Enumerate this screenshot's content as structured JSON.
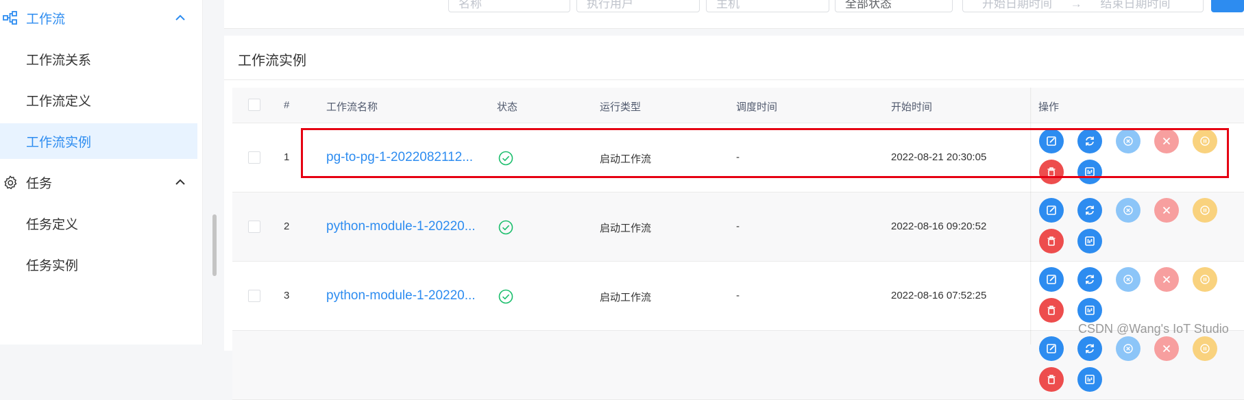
{
  "sidebar": {
    "groups": [
      {
        "label": "工作流",
        "icon": "workflow-icon"
      },
      {
        "label": "任务",
        "icon": "gear-icon"
      }
    ],
    "workflow_items": [
      {
        "label": "工作流关系"
      },
      {
        "label": "工作流定义"
      },
      {
        "label": "工作流实例"
      }
    ],
    "task_items": [
      {
        "label": "任务定义"
      },
      {
        "label": "任务实例"
      }
    ],
    "active": "工作流实例"
  },
  "filters": {
    "name_placeholder": "名称",
    "executor_placeholder": "执行用户",
    "host_placeholder": "主机",
    "state_value": "全部状态",
    "start_date_placeholder": "开始日期时间",
    "end_date_placeholder": "结束日期时间",
    "range_separator": "→"
  },
  "card": {
    "title": "工作流实例"
  },
  "table": {
    "headers": {
      "index": "#",
      "name": "工作流名称",
      "state": "状态",
      "run_type": "运行类型",
      "schedule_time": "调度时间",
      "start_time": "开始时间",
      "operations": "操作"
    },
    "rows": [
      {
        "index": "1",
        "name": "pg-to-pg-1-2022082112...",
        "state_icon": "success-check-icon",
        "run_type": "启动工作流",
        "schedule_time": "-",
        "start_time": "2022-08-21 20:30:05"
      },
      {
        "index": "2",
        "name": "python-module-1-20220...",
        "state_icon": "success-check-icon",
        "run_type": "启动工作流",
        "schedule_time": "-",
        "start_time": "2022-08-16 09:20:52"
      },
      {
        "index": "3",
        "name": "python-module-1-20220...",
        "state_icon": "success-check-icon",
        "run_type": "启动工作流",
        "schedule_time": "-",
        "start_time": "2022-08-16 07:52:25"
      }
    ],
    "operation_icons": [
      "edit-icon",
      "rerun-icon",
      "stop-icon",
      "close-icon",
      "pause-icon",
      "delete-icon",
      "gantt-icon"
    ]
  },
  "colors": {
    "primary": "#2d8cf0",
    "success": "#19be6b",
    "danger": "#ed4d4d",
    "highlight_box": "#e60012"
  },
  "watermark": "CSDN @Wang's IoT Studio"
}
